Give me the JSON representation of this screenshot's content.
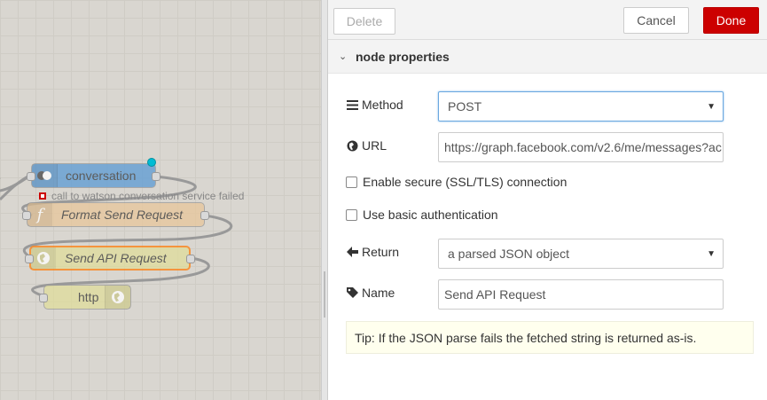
{
  "canvas": {
    "nodes": [
      {
        "id": "conversation",
        "label": "conversation",
        "color": "#5b9bd5",
        "italic": false,
        "selected": false
      },
      {
        "id": "format",
        "label": "Format Send Request",
        "color": "#e8c79b",
        "italic": true,
        "selected": false
      },
      {
        "id": "sendapi",
        "label": "Send API Request",
        "color": "#e0dd9b",
        "italic": true,
        "selected": true
      },
      {
        "id": "http",
        "label": "http",
        "color": "#e0dd9b",
        "italic": false,
        "selected": false
      }
    ],
    "status_text": "call to watson conversation service failed"
  },
  "toolbar": {
    "delete_label": "Delete",
    "cancel_label": "Cancel",
    "done_label": "Done"
  },
  "section": {
    "title": "node properties"
  },
  "form": {
    "method": {
      "label": "Method",
      "value": "POST",
      "icon": "list-icon"
    },
    "url": {
      "label": "URL",
      "value": "https://graph.facebook.com/v2.6/me/messages?ac",
      "icon": "globe-icon"
    },
    "ssl": {
      "label": "Enable secure (SSL/TLS) connection",
      "checked": false
    },
    "auth": {
      "label": "Use basic authentication",
      "checked": false
    },
    "return": {
      "label": "Return",
      "value": "a parsed JSON object",
      "icon": "arrow-left-icon"
    },
    "name": {
      "label": "Name",
      "value": "Send API Request",
      "icon": "tag-icon"
    }
  },
  "tip": {
    "text": "Tip: If the JSON parse fails the fetched string is returned as-is."
  },
  "colors": {
    "accent": "#cc0000",
    "focus": "#6aa8e0"
  }
}
